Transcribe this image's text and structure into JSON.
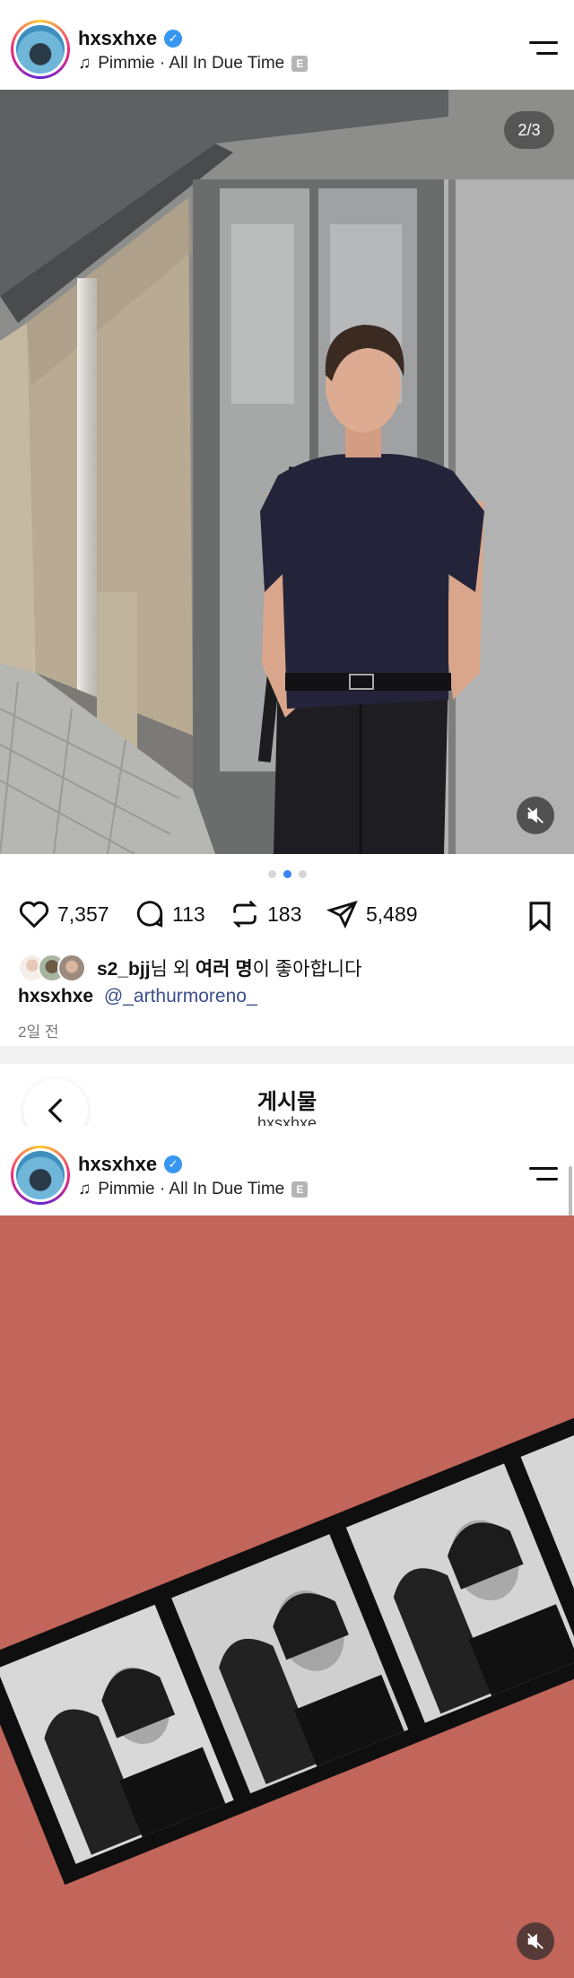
{
  "post1": {
    "username": "hxsxhxe",
    "music": "Pimmie · All In Due Time",
    "explicit_badge": "E",
    "media_counter": "2/3",
    "actions": {
      "likes": "7,357",
      "comments": "113",
      "reposts": "183",
      "shares": "5,489"
    },
    "liked_by": {
      "user": "s2_bjj",
      "suffix1": "님 외 ",
      "others": "여러 명",
      "suffix2": "이 좋아합니다"
    },
    "caption": {
      "user": "hxsxhxe",
      "mention": "@_arthurmoreno_"
    },
    "time_ago": "2일 전",
    "carousel": {
      "count": 3,
      "active_index": 1
    }
  },
  "sub_header": {
    "title": "게시물",
    "username": "hxsxhxe"
  },
  "post2": {
    "username": "hxsxhxe",
    "music": "Pimmie · All In Due Time",
    "explicit_badge": "E"
  },
  "colors": {
    "verified": "#3797f0",
    "link": "#3b4f8a",
    "dot_active": "#3b82f6",
    "photo2_background": "#c06358"
  },
  "icons": [
    "verified-icon",
    "music-note-icon",
    "menu-icon",
    "mute-icon",
    "heart-icon",
    "comment-icon",
    "repost-icon",
    "share-icon",
    "bookmark-icon",
    "back-icon"
  ]
}
